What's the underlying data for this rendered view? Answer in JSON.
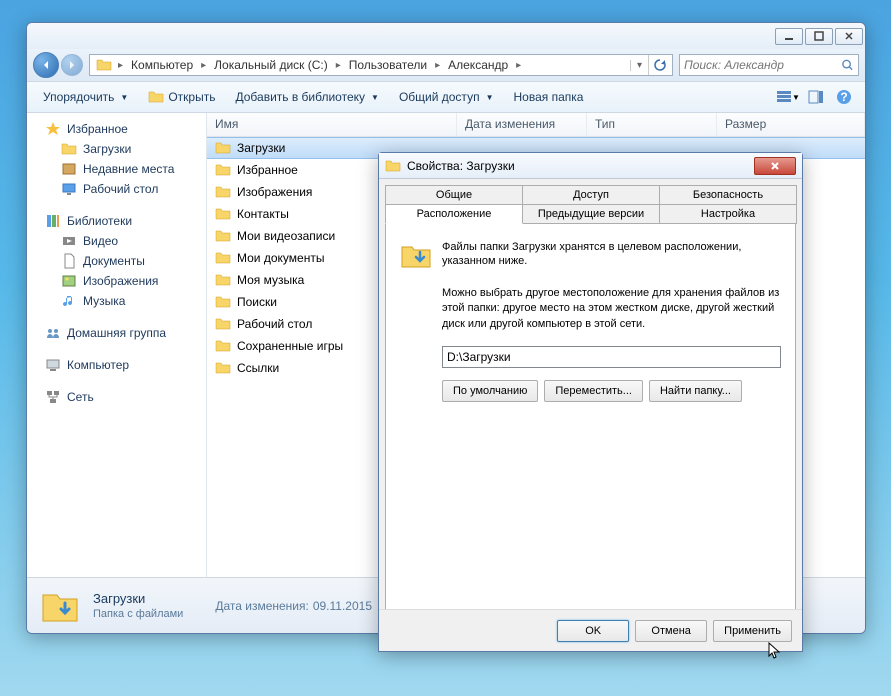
{
  "title_buttons": {
    "min": "minimize",
    "max": "maximize",
    "close": "close"
  },
  "breadcrumb": {
    "segments": [
      "Компьютер",
      "Локальный диск (С:)",
      "Пользователи",
      "Александр"
    ],
    "search_placeholder": "Поиск: Александр"
  },
  "toolbar": {
    "organize": "Упорядочить",
    "open": "Открыть",
    "library": "Добавить в библиотеку",
    "share": "Общий доступ",
    "newfolder": "Новая папка"
  },
  "sidebar": {
    "favorites": {
      "label": "Избранное",
      "items": [
        "Загрузки",
        "Недавние места",
        "Рабочий стол"
      ]
    },
    "libraries": {
      "label": "Библиотеки",
      "items": [
        "Видео",
        "Документы",
        "Изображения",
        "Музыка"
      ]
    },
    "homegroup": {
      "label": "Домашняя группа"
    },
    "computer": {
      "label": "Компьютер"
    },
    "network": {
      "label": "Сеть"
    }
  },
  "columns": {
    "name": "Имя",
    "date": "Дата изменения",
    "type": "Тип",
    "size": "Размер"
  },
  "files": [
    "Загрузки",
    "Избранное",
    "Изображения",
    "Контакты",
    "Мои видеозаписи",
    "Мои документы",
    "Моя музыка",
    "Поиски",
    "Рабочий стол",
    "Сохраненные игры",
    "Ссылки"
  ],
  "status": {
    "title": "Загрузки",
    "sub": "Папка с файлами",
    "meta_label": "Дата изменения:",
    "meta_value": "09.11.2015"
  },
  "dialog": {
    "title": "Свойства: Загрузки",
    "tabs_top": [
      "Общие",
      "Доступ",
      "Безопасность"
    ],
    "tabs_bottom": [
      "Расположение",
      "Предыдущие версии",
      "Настройка"
    ],
    "active_tab": "Расположение",
    "info_text": "Файлы папки Загрузки хранятся в целевом расположении, указанном ниже.",
    "desc_text": "Можно выбрать другое местоположение для хранения файлов из этой папки: другое место на этом жестком диске, другой жесткий диск или другой компьютер в этой сети.",
    "path_value": "D:\\Загрузки",
    "btn_default": "По умолчанию",
    "btn_move": "Переместить...",
    "btn_find": "Найти папку...",
    "btn_ok": "OK",
    "btn_cancel": "Отмена",
    "btn_apply": "Применить"
  }
}
